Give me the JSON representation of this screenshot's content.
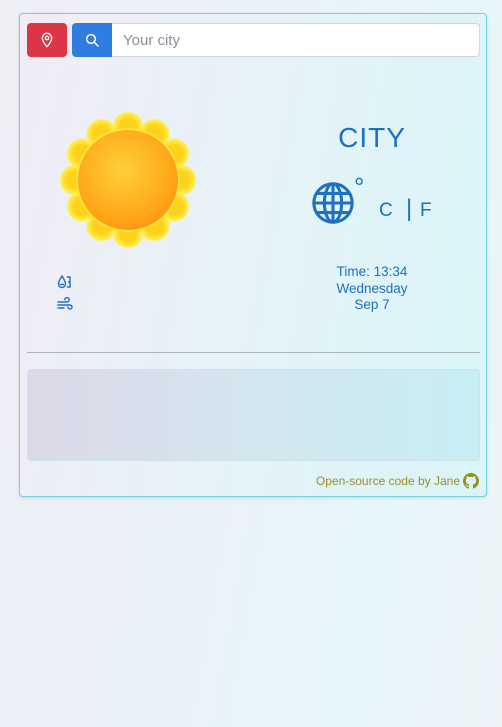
{
  "search": {
    "placeholder": "Your city"
  },
  "location_button": {
    "icon": "map-pin-icon"
  },
  "search_button": {
    "icon": "search-icon"
  },
  "weather": {
    "city": "CITY",
    "temperature": "",
    "degree_symbol": "°",
    "unit_c": "C",
    "unit_separator": "|",
    "unit_f": "F",
    "condition_icon": "sun-icon",
    "temp_icon": "globe-icon",
    "humidity_icon": "droplet-icon",
    "wind_icon": "wind-icon"
  },
  "time": {
    "time_label": "Time: 13:34",
    "weekday": "Wednesday",
    "date": "Sep 7"
  },
  "footer": {
    "text": "Open-source code by Jane",
    "icon": "github-icon"
  },
  "colors": {
    "accent": "#1e70c1",
    "location_button": "#dc3545",
    "search_button": "#2f7de1",
    "footer_link": "#9a8d28",
    "sun_core": "#ffb020",
    "sun_petals": "#ffe040"
  }
}
